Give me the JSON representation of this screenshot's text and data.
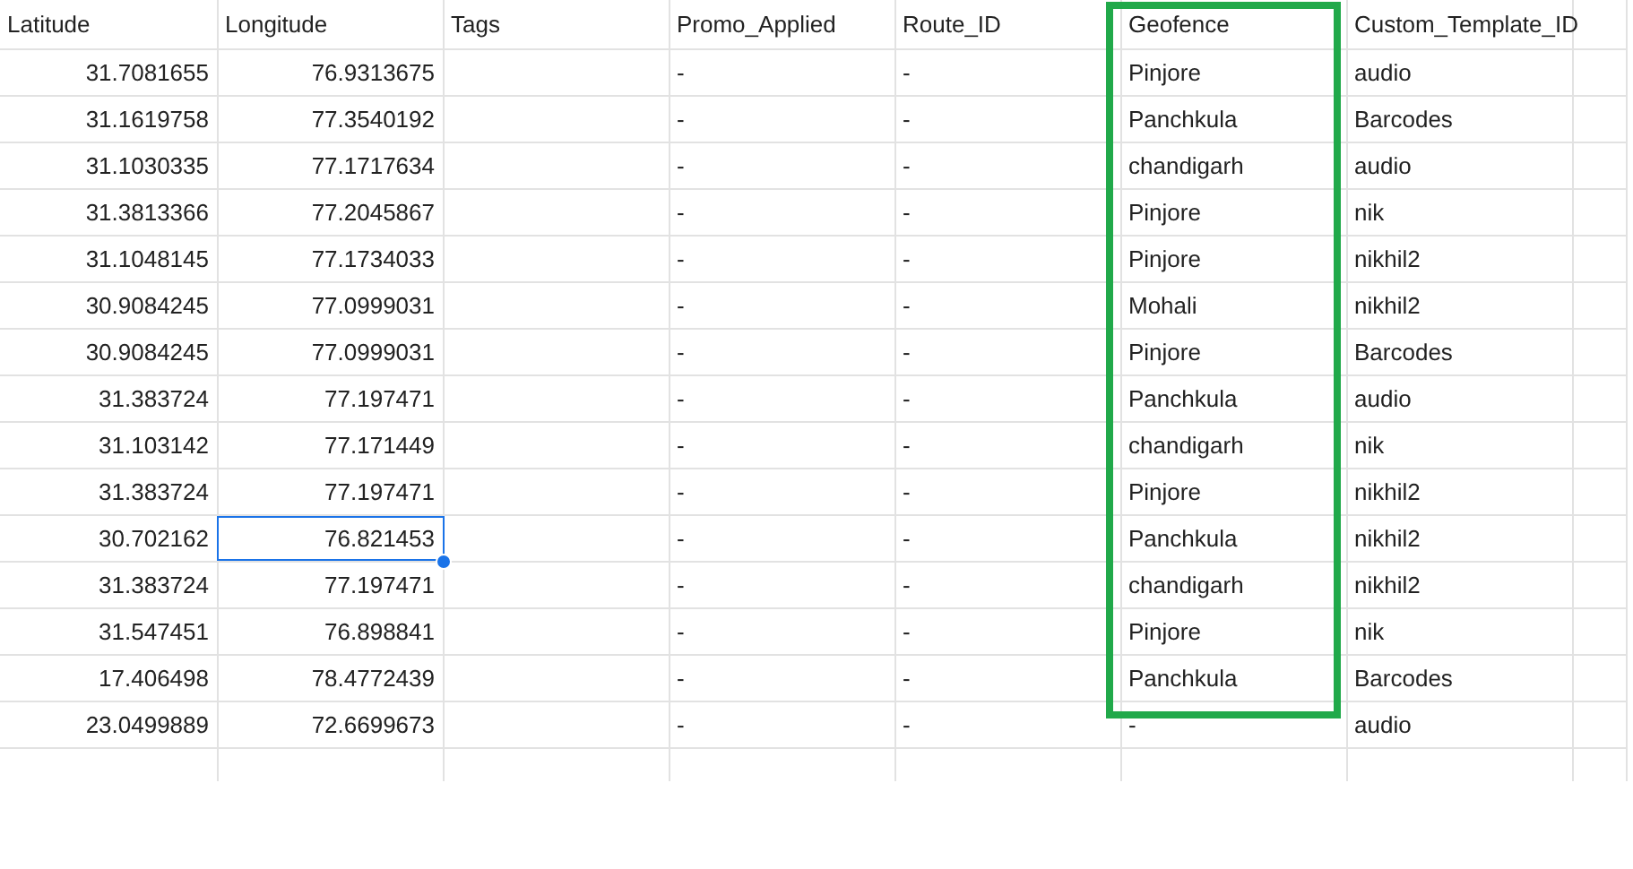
{
  "columns": [
    {
      "label": "Latitude",
      "highlighted": false
    },
    {
      "label": "Longitude",
      "highlighted": false
    },
    {
      "label": "Tags",
      "highlighted": false
    },
    {
      "label": "Promo_Applied",
      "highlighted": false
    },
    {
      "label": "Route_ID",
      "highlighted": false
    },
    {
      "label": "Geofence",
      "highlighted": true
    },
    {
      "label": "Custom_Template_ID",
      "highlighted": false
    }
  ],
  "rows": [
    {
      "cells": [
        "31.7081655",
        "76.9313675",
        "",
        "-",
        "-",
        "Pinjore",
        "audio"
      ],
      "selected": false
    },
    {
      "cells": [
        "31.1619758",
        "77.3540192",
        "",
        "-",
        "-",
        "Panchkula",
        "Barcodes"
      ],
      "selected": false
    },
    {
      "cells": [
        "31.1030335",
        "77.1717634",
        "",
        "-",
        "-",
        "chandigarh",
        "audio"
      ],
      "selected": false
    },
    {
      "cells": [
        "31.3813366",
        "77.2045867",
        "",
        "-",
        "-",
        "Pinjore",
        "nik"
      ],
      "selected": false
    },
    {
      "cells": [
        "31.1048145",
        "77.1734033",
        "",
        "-",
        "-",
        "Pinjore",
        "nikhil2"
      ],
      "selected": false
    },
    {
      "cells": [
        "30.9084245",
        "77.0999031",
        "",
        "-",
        "-",
        "Mohali",
        "nikhil2"
      ],
      "selected": false
    },
    {
      "cells": [
        "30.9084245",
        "77.0999031",
        "",
        "-",
        "-",
        "Pinjore",
        "Barcodes"
      ],
      "selected": false
    },
    {
      "cells": [
        "31.383724",
        "77.197471",
        "",
        "-",
        "-",
        "Panchkula",
        "audio"
      ],
      "selected": false
    },
    {
      "cells": [
        "31.103142",
        "77.171449",
        "",
        "-",
        "-",
        "chandigarh",
        "nik"
      ],
      "selected": false
    },
    {
      "cells": [
        "31.383724",
        "77.197471",
        "",
        "-",
        "-",
        "Pinjore",
        "nikhil2"
      ],
      "selected": false
    },
    {
      "cells": [
        "30.702162",
        "76.821453",
        "",
        "-",
        "-",
        "Panchkula",
        "nikhil2"
      ],
      "selected": true
    },
    {
      "cells": [
        "31.383724",
        "77.197471",
        "",
        "-",
        "-",
        "chandigarh",
        "nikhil2"
      ],
      "selected": false
    },
    {
      "cells": [
        "31.547451",
        "76.898841",
        "",
        "-",
        "-",
        "Pinjore",
        "nik"
      ],
      "selected": false
    },
    {
      "cells": [
        "17.406498",
        "78.4772439",
        "",
        "-",
        "-",
        "Panchkula",
        "Barcodes"
      ],
      "selected": false
    },
    {
      "cells": [
        "23.0499889",
        "72.6699673",
        "",
        "-",
        "-",
        "-",
        "audio"
      ],
      "selected": false
    }
  ]
}
